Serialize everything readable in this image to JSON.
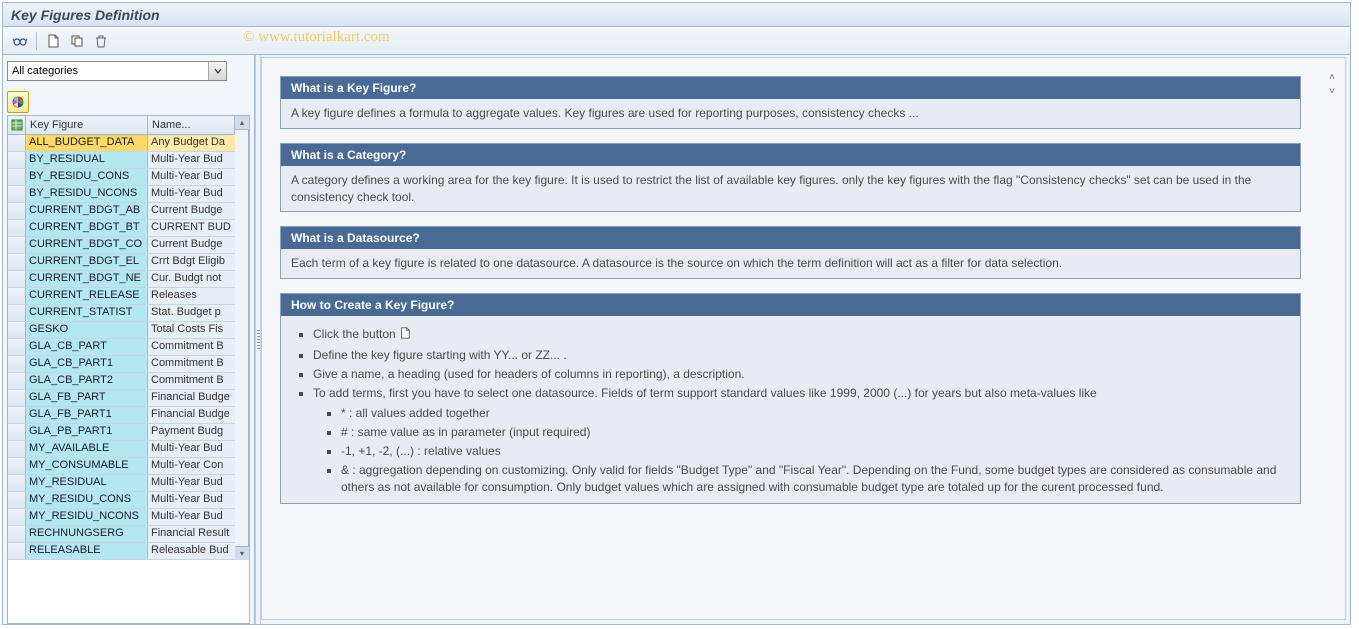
{
  "title": "Key Figures Definition",
  "watermark": "© www.tutorialkart.com",
  "toolbar": {
    "display_icon": "display-icon",
    "create_icon": "create-icon",
    "copy_icon": "copy-icon",
    "delete_icon": "delete-icon"
  },
  "filter": {
    "selected": "All categories"
  },
  "table": {
    "header_key": "Key Figure",
    "header_name": "Name...",
    "rows": [
      {
        "key": "ALL_BUDGET_DATA",
        "name": "Any Budget Da",
        "selected": true
      },
      {
        "key": "BY_RESIDUAL",
        "name": "Multi-Year Bud"
      },
      {
        "key": "BY_RESIDU_CONS",
        "name": "Multi-Year Bud"
      },
      {
        "key": "BY_RESIDU_NCONS",
        "name": "Multi-Year Bud"
      },
      {
        "key": "CURRENT_BDGT_AB",
        "name": "Current Budge"
      },
      {
        "key": "CURRENT_BDGT_BT",
        "name": "CURRENT BUD"
      },
      {
        "key": "CURRENT_BDGT_CO",
        "name": "Current Budge"
      },
      {
        "key": "CURRENT_BDGT_EL",
        "name": "Crrt Bdgt Eligib"
      },
      {
        "key": "CURRENT_BDGT_NE",
        "name": "Cur. Budgt not"
      },
      {
        "key": "CURRENT_RELEASE",
        "name": "Releases"
      },
      {
        "key": "CURRENT_STATIST",
        "name": "Stat. Budget p"
      },
      {
        "key": "GESKO",
        "name": "Total Costs Fis"
      },
      {
        "key": "GLA_CB_PART",
        "name": "Commitment B"
      },
      {
        "key": "GLA_CB_PART1",
        "name": "Commitment B"
      },
      {
        "key": "GLA_CB_PART2",
        "name": "Commitment B"
      },
      {
        "key": "GLA_FB_PART",
        "name": "Financial Budge"
      },
      {
        "key": "GLA_FB_PART1",
        "name": "Financial Budge"
      },
      {
        "key": "GLA_PB_PART1",
        "name": "Payment Budg"
      },
      {
        "key": "MY_AVAILABLE",
        "name": "Multi-Year Bud"
      },
      {
        "key": "MY_CONSUMABLE",
        "name": "Multi-Year Con"
      },
      {
        "key": "MY_RESIDUAL",
        "name": "Multi-Year Bud"
      },
      {
        "key": "MY_RESIDU_CONS",
        "name": "Multi-Year Bud"
      },
      {
        "key": "MY_RESIDU_NCONS",
        "name": "Multi-Year Bud"
      },
      {
        "key": "RECHNUNGSERG",
        "name": "Financial Result"
      },
      {
        "key": "RELEASABLE",
        "name": "Releasable Bud"
      }
    ]
  },
  "help": {
    "p1": {
      "title": "What is a Key Figure?",
      "body": "A key figure defines a formula to aggregate values. Key figures are used for reporting purposes, consistency checks ..."
    },
    "p2": {
      "title": "What is a Category?",
      "body": "A category defines a working area for the key figure. It is used to restrict the list of available key figures. only the key figures with the flag \"Consistency checks\" set can be used in the consistency check tool."
    },
    "p3": {
      "title": "What is a Datasource?",
      "body": "Each term of a key figure is related to one datasource. A datasource is the source on which the term definition will act as a filter for data selection."
    },
    "p4": {
      "title": "How to Create a Key Figure?",
      "li1": "Click the button",
      "li2": "Define the key figure starting with YY... or ZZ... .",
      "li3": "Give a name, a heading (used for headers of columns in reporting), a description.",
      "li4": "To add terms, first you have to select one datasource. Fields of term support standard values like 1999, 2000 (...) for years but also meta-values like",
      "sub1": "* : all values added together",
      "sub2": "# : same value as in parameter (input required)",
      "sub3": "-1, +1, -2, (...) : relative values",
      "sub4": "& : aggregation depending on customizing. Only valid for fields \"Budget Type\" and \"Fiscal Year\". Depending on the Fund, some budget types are considered as consumable and others as not available for consumption. Only budget values which are assigned with consumable budget type are totaled up for the curent processed fund."
    }
  }
}
